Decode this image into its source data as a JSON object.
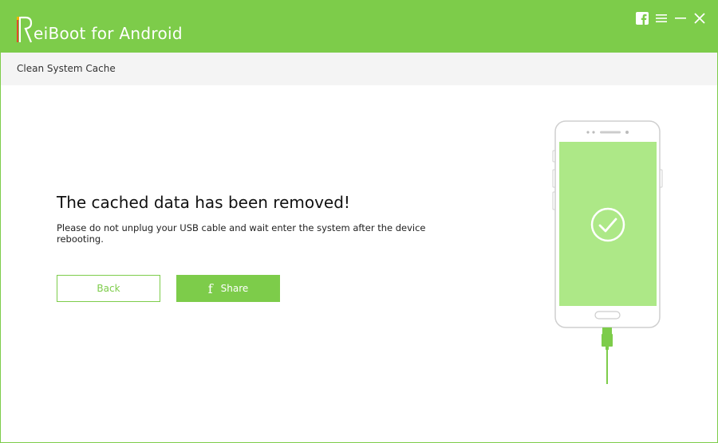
{
  "app": {
    "title": "ReiBoot for Android",
    "title_rest": "eiBoot for Android"
  },
  "window_controls": [
    "facebook-icon",
    "menu-icon",
    "minimize-icon",
    "close-icon"
  ],
  "subheader": {
    "label": "Clean System Cache"
  },
  "main": {
    "heading": "The cached data has been removed!",
    "description": "Please do not unplug your USB cable and wait enter the system after the device rebooting."
  },
  "buttons": {
    "back_label": "Back",
    "share_label": "Share",
    "share_icon": "facebook-f-icon"
  },
  "illustration": {
    "status": "success-check-icon"
  },
  "colors": {
    "accent": "#7dcc4a",
    "screen": "#ade887",
    "subheader_bg": "#f4f4f4"
  }
}
